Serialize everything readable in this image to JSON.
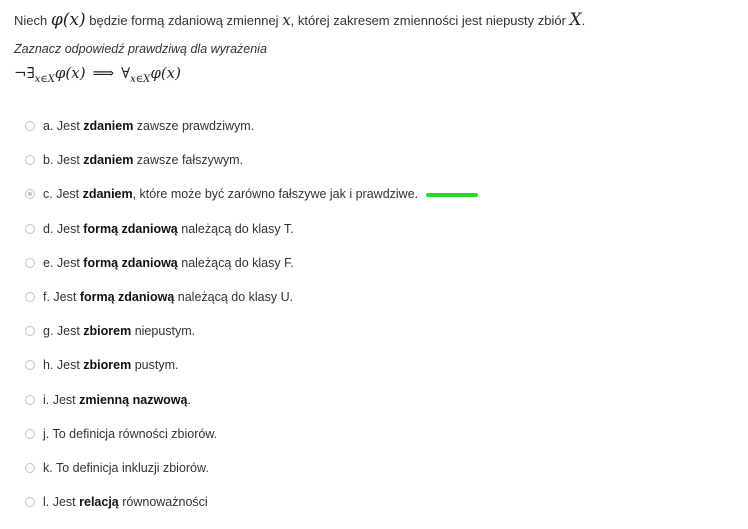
{
  "question": {
    "part1": "Niech ",
    "phi_x_1": "φ(x)",
    "part2": " będzie formą zdaniową zmiennej ",
    "var_x": "x",
    "part3": ", której zakresem zmienności jest niepusty zbiór ",
    "set_X": "X",
    "part4": "."
  },
  "instruction": "Zaznacz odpowiedź prawdziwą dla wyrażenia",
  "formula": {
    "lhs_prefix": "¬∃",
    "lhs_sub": "x∈X",
    "lhs_phi": "φ(x)",
    "arrow": "⟹",
    "rhs_prefix": "∀",
    "rhs_sub": "x∈X",
    "rhs_phi": "φ(x)"
  },
  "options": [
    {
      "pre": "a. Jest ",
      "bold": "zdaniem",
      "post": " zawsze prawdziwym.",
      "checked": false
    },
    {
      "pre": "b. Jest ",
      "bold": "zdaniem",
      "post": " zawsze fałszywym.",
      "checked": false
    },
    {
      "pre": "c. Jest ",
      "bold": "zdaniem",
      "post": ", które może być zarówno fałszywe jak i prawdziwe.",
      "checked": true,
      "marker_color": "#1ee01e"
    },
    {
      "pre": "d. Jest ",
      "bold": "formą zdaniową",
      "post": " należącą do klasy T.",
      "checked": false
    },
    {
      "pre": "e. Jest ",
      "bold": "formą zdaniową",
      "post": " należącą do klasy F.",
      "checked": false
    },
    {
      "pre": "f. Jest ",
      "bold": "formą zdaniową",
      "post": " należącą do klasy U.",
      "checked": false
    },
    {
      "pre": "g. Jest ",
      "bold": "zbiorem",
      "post": " niepustym.",
      "checked": false
    },
    {
      "pre": "h. Jest ",
      "bold": "zbiorem",
      "post": " pustym.",
      "checked": false
    },
    {
      "pre": "i. Jest ",
      "bold": "zmienną nazwową",
      "post": ".",
      "checked": false
    },
    {
      "pre": "j. To definicja równości zbiorów.",
      "bold": "",
      "post": "",
      "checked": false
    },
    {
      "pre": "k. To definicja inkluzji zbiorów.",
      "bold": "",
      "post": "",
      "checked": false
    },
    {
      "pre": "l. Jest ",
      "bold": "relacją",
      "post": " równoważności",
      "checked": false
    }
  ],
  "colors": {
    "radio_border": "#c4c4c4",
    "text": "#333333",
    "correct_marker": "#1ee01e"
  }
}
